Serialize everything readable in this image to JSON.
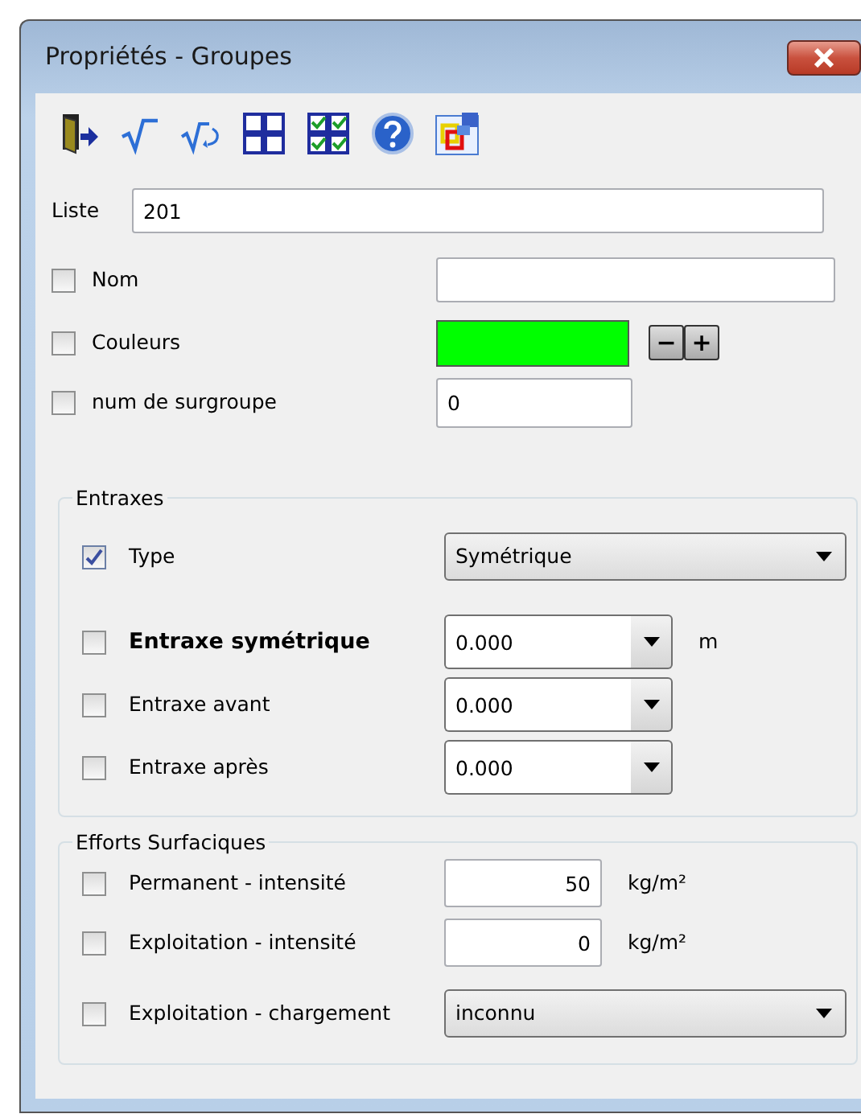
{
  "window": {
    "title": "Propriétés - Groupes"
  },
  "liste": {
    "label": "Liste",
    "value": "201"
  },
  "fields": [
    {
      "kind": "text",
      "label": "Nom",
      "checked": false
    },
    {
      "kind": "color",
      "label": "Couleurs",
      "checked": false,
      "color": "#00ff00",
      "buttons": [
        "−",
        "+"
      ]
    },
    {
      "kind": "short",
      "label": "num de surgroupe",
      "checked": false,
      "value": "0"
    }
  ],
  "groups": [
    {
      "title": "Entraxes",
      "rows": [
        {
          "kind": "select",
          "label": "Type",
          "checked": true,
          "value": "Symétrique"
        },
        {
          "kind": "combo",
          "label": "Entraxe symétrique",
          "bold": true,
          "checked": false,
          "value": "0.000",
          "unit": "m"
        },
        {
          "kind": "combo",
          "label": "Entraxe avant",
          "bold": false,
          "checked": false,
          "value": "0.000"
        },
        {
          "kind": "combo",
          "label": "Entraxe après",
          "bold": false,
          "checked": false,
          "value": "0.000"
        }
      ]
    },
    {
      "title": "Efforts Surfaciques",
      "rows": [
        {
          "kind": "number",
          "label": "Permanent - intensité",
          "checked": false,
          "value": "50",
          "unit": "kg/m²"
        },
        {
          "kind": "number",
          "label": "Exploitation - intensité",
          "checked": false,
          "value": "0",
          "unit": "kg/m²"
        },
        {
          "kind": "select",
          "label": "Exploitation - chargement",
          "checked": false,
          "value": "inconnu"
        }
      ]
    }
  ]
}
